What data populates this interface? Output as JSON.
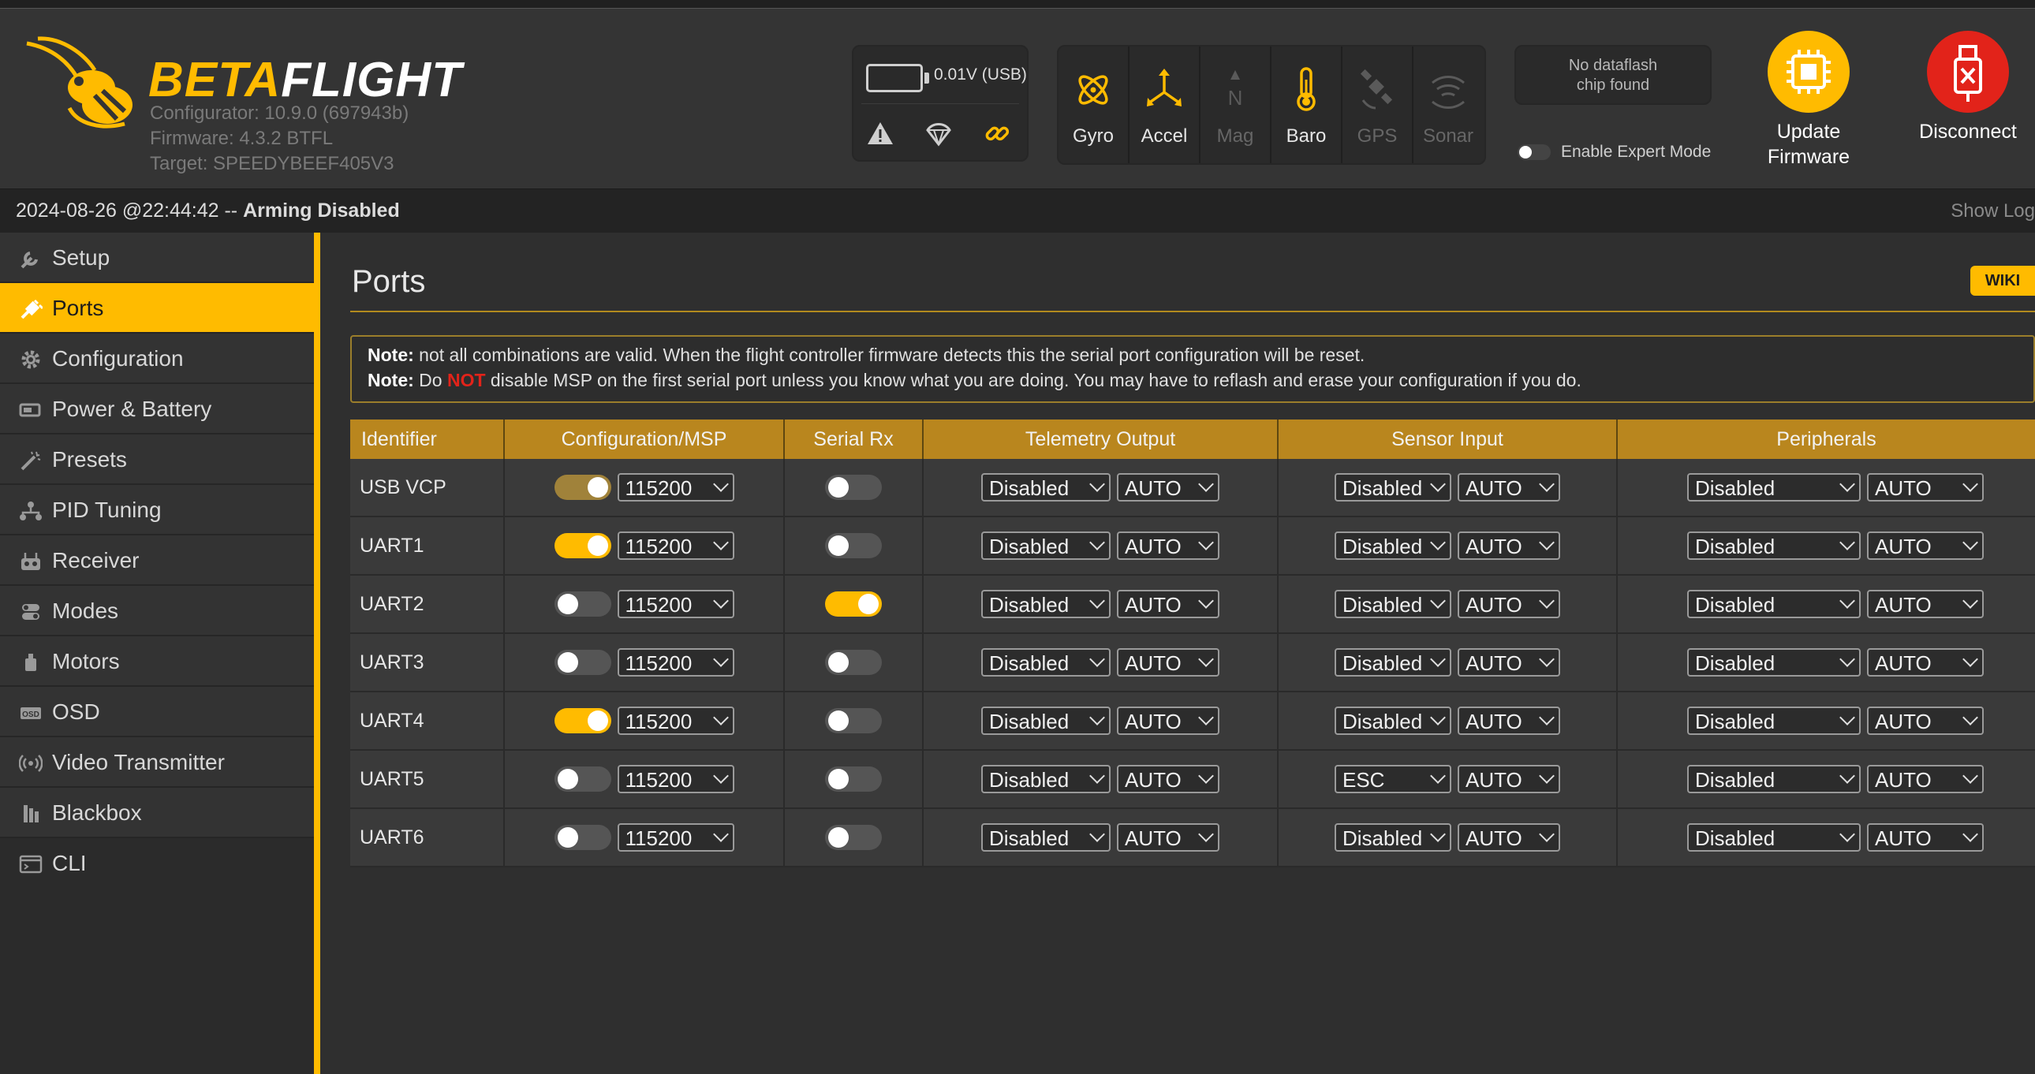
{
  "app": {
    "logo_beta": "BETA",
    "logo_flight": "FLIGHT",
    "configurator": "Configurator: 10.9.0 (697943b)",
    "firmware": "Firmware: 4.3.2 BTFL",
    "target": "Target: SPEEDYBEEF405V3",
    "accent_color": "#ffbb00"
  },
  "battery": {
    "text": "0.01V (USB)",
    "icons": [
      "warning-icon",
      "failsafe-icon",
      "link-icon"
    ]
  },
  "sensors": [
    {
      "label": "Gyro",
      "state": "on",
      "icon": "gyro-icon"
    },
    {
      "label": "Accel",
      "state": "on",
      "icon": "accel-icon"
    },
    {
      "label": "Mag",
      "state": "off",
      "icon": "mag-icon"
    },
    {
      "label": "Baro",
      "state": "on",
      "icon": "baro-icon"
    },
    {
      "label": "GPS",
      "state": "off",
      "icon": "gps-icon"
    },
    {
      "label": "Sonar",
      "state": "off",
      "icon": "sonar-icon"
    }
  ],
  "dataflash": {
    "line1": "No dataflash",
    "line2": "chip found"
  },
  "expert_mode": {
    "label": "Enable Expert Mode",
    "enabled": false
  },
  "update_firmware": {
    "line1": "Update",
    "line2": "Firmware"
  },
  "disconnect": {
    "label": "Disconnect"
  },
  "status": {
    "timestamp": "2024-08-26 @22:44:42 --",
    "state": "Arming Disabled",
    "show_log": "Show Log"
  },
  "sidebar": {
    "items": [
      {
        "label": "Setup",
        "icon": "wrench-icon"
      },
      {
        "label": "Ports",
        "icon": "plug-icon",
        "active": true
      },
      {
        "label": "Configuration",
        "icon": "gear-icon"
      },
      {
        "label": "Power & Battery",
        "icon": "battery-icon"
      },
      {
        "label": "Presets",
        "icon": "wand-icon"
      },
      {
        "label": "PID Tuning",
        "icon": "pid-icon"
      },
      {
        "label": "Receiver",
        "icon": "receiver-icon"
      },
      {
        "label": "Modes",
        "icon": "modes-icon"
      },
      {
        "label": "Motors",
        "icon": "motor-icon"
      },
      {
        "label": "OSD",
        "icon": "osd-icon"
      },
      {
        "label": "Video Transmitter",
        "icon": "vtx-icon"
      },
      {
        "label": "Blackbox",
        "icon": "blackbox-icon"
      },
      {
        "label": "CLI",
        "icon": "terminal-icon"
      }
    ]
  },
  "page": {
    "title": "Ports",
    "wiki": "WIKI",
    "note1_bold": "Note:",
    "note1_text": " not all combinations are valid. When the flight controller firmware detects this the serial port configuration will be reset.",
    "note2_bold": "Note:",
    "note2_pre": " Do ",
    "note2_red": "NOT",
    "note2_post": " disable MSP on the first serial port unless you know what you are doing. You may have to reflash and erase your configuration if you do."
  },
  "table": {
    "headers": [
      "Identifier",
      "Configuration/MSP",
      "Serial Rx",
      "Telemetry Output",
      "Sensor Input",
      "Peripherals"
    ],
    "rows": [
      {
        "id": "USB VCP",
        "msp": "dim",
        "baud": "115200",
        "rx": "off",
        "telemetry": "Disabled",
        "telemetry_baud": "AUTO",
        "sensor": "Disabled",
        "sensor_baud": "AUTO",
        "peripheral": "Disabled",
        "peripheral_baud": "AUTO"
      },
      {
        "id": "UART1",
        "msp": "on",
        "baud": "115200",
        "rx": "off",
        "telemetry": "Disabled",
        "telemetry_baud": "AUTO",
        "sensor": "Disabled",
        "sensor_baud": "AUTO",
        "peripheral": "Disabled",
        "peripheral_baud": "AUTO"
      },
      {
        "id": "UART2",
        "msp": "off",
        "baud": "115200",
        "rx": "on",
        "telemetry": "Disabled",
        "telemetry_baud": "AUTO",
        "sensor": "Disabled",
        "sensor_baud": "AUTO",
        "peripheral": "Disabled",
        "peripheral_baud": "AUTO"
      },
      {
        "id": "UART3",
        "msp": "off",
        "baud": "115200",
        "rx": "off",
        "telemetry": "Disabled",
        "telemetry_baud": "AUTO",
        "sensor": "Disabled",
        "sensor_baud": "AUTO",
        "peripheral": "Disabled",
        "peripheral_baud": "AUTO"
      },
      {
        "id": "UART4",
        "msp": "on",
        "baud": "115200",
        "rx": "off",
        "telemetry": "Disabled",
        "telemetry_baud": "AUTO",
        "sensor": "Disabled",
        "sensor_baud": "AUTO",
        "peripheral": "Disabled",
        "peripheral_baud": "AUTO"
      },
      {
        "id": "UART5",
        "msp": "off",
        "baud": "115200",
        "rx": "off",
        "telemetry": "Disabled",
        "telemetry_baud": "AUTO",
        "sensor": "ESC",
        "sensor_baud": "AUTO",
        "peripheral": "Disabled",
        "peripheral_baud": "AUTO"
      },
      {
        "id": "UART6",
        "msp": "off",
        "baud": "115200",
        "rx": "off",
        "telemetry": "Disabled",
        "telemetry_baud": "AUTO",
        "sensor": "Disabled",
        "sensor_baud": "AUTO",
        "peripheral": "Disabled",
        "peripheral_baud": "AUTO"
      }
    ]
  }
}
